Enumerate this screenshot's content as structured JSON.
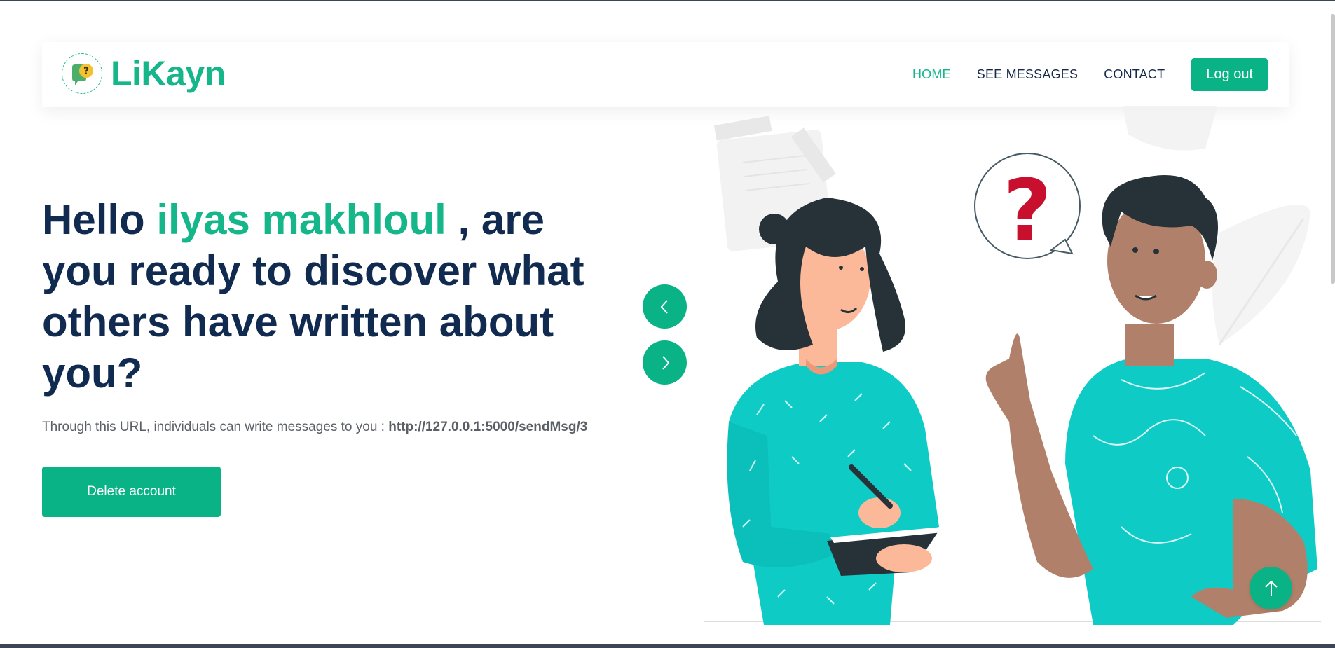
{
  "brand": {
    "name": "LiKayn",
    "logo_icon": "question-speech-bubble-icon"
  },
  "nav": {
    "items": [
      {
        "label": "HOME",
        "active": true
      },
      {
        "label": "SEE MESSAGES",
        "active": false
      },
      {
        "label": "CONTACT",
        "active": false
      }
    ],
    "logout_label": "Log out"
  },
  "hero": {
    "title_prefix": "Hello ",
    "user_name": "ilyas makhloul",
    "title_suffix": " , are you ready to discover what others have written about you?",
    "subtitle": "Through this URL, individuals can write messages to you : ",
    "share_url": "http://127.0.0.1:5000/sendMsg/3",
    "delete_label": "Delete account"
  },
  "carousel": {
    "prev_icon": "chevron-left-icon",
    "next_icon": "chevron-right-icon"
  },
  "illustration": {
    "bubble_text": "?"
  },
  "back_to_top": {
    "icon": "arrow-up-icon"
  },
  "colors": {
    "accent": "#09b386",
    "heading": "#102a50",
    "shirt": "#0ecbc6",
    "question_mark": "#c8102e"
  }
}
